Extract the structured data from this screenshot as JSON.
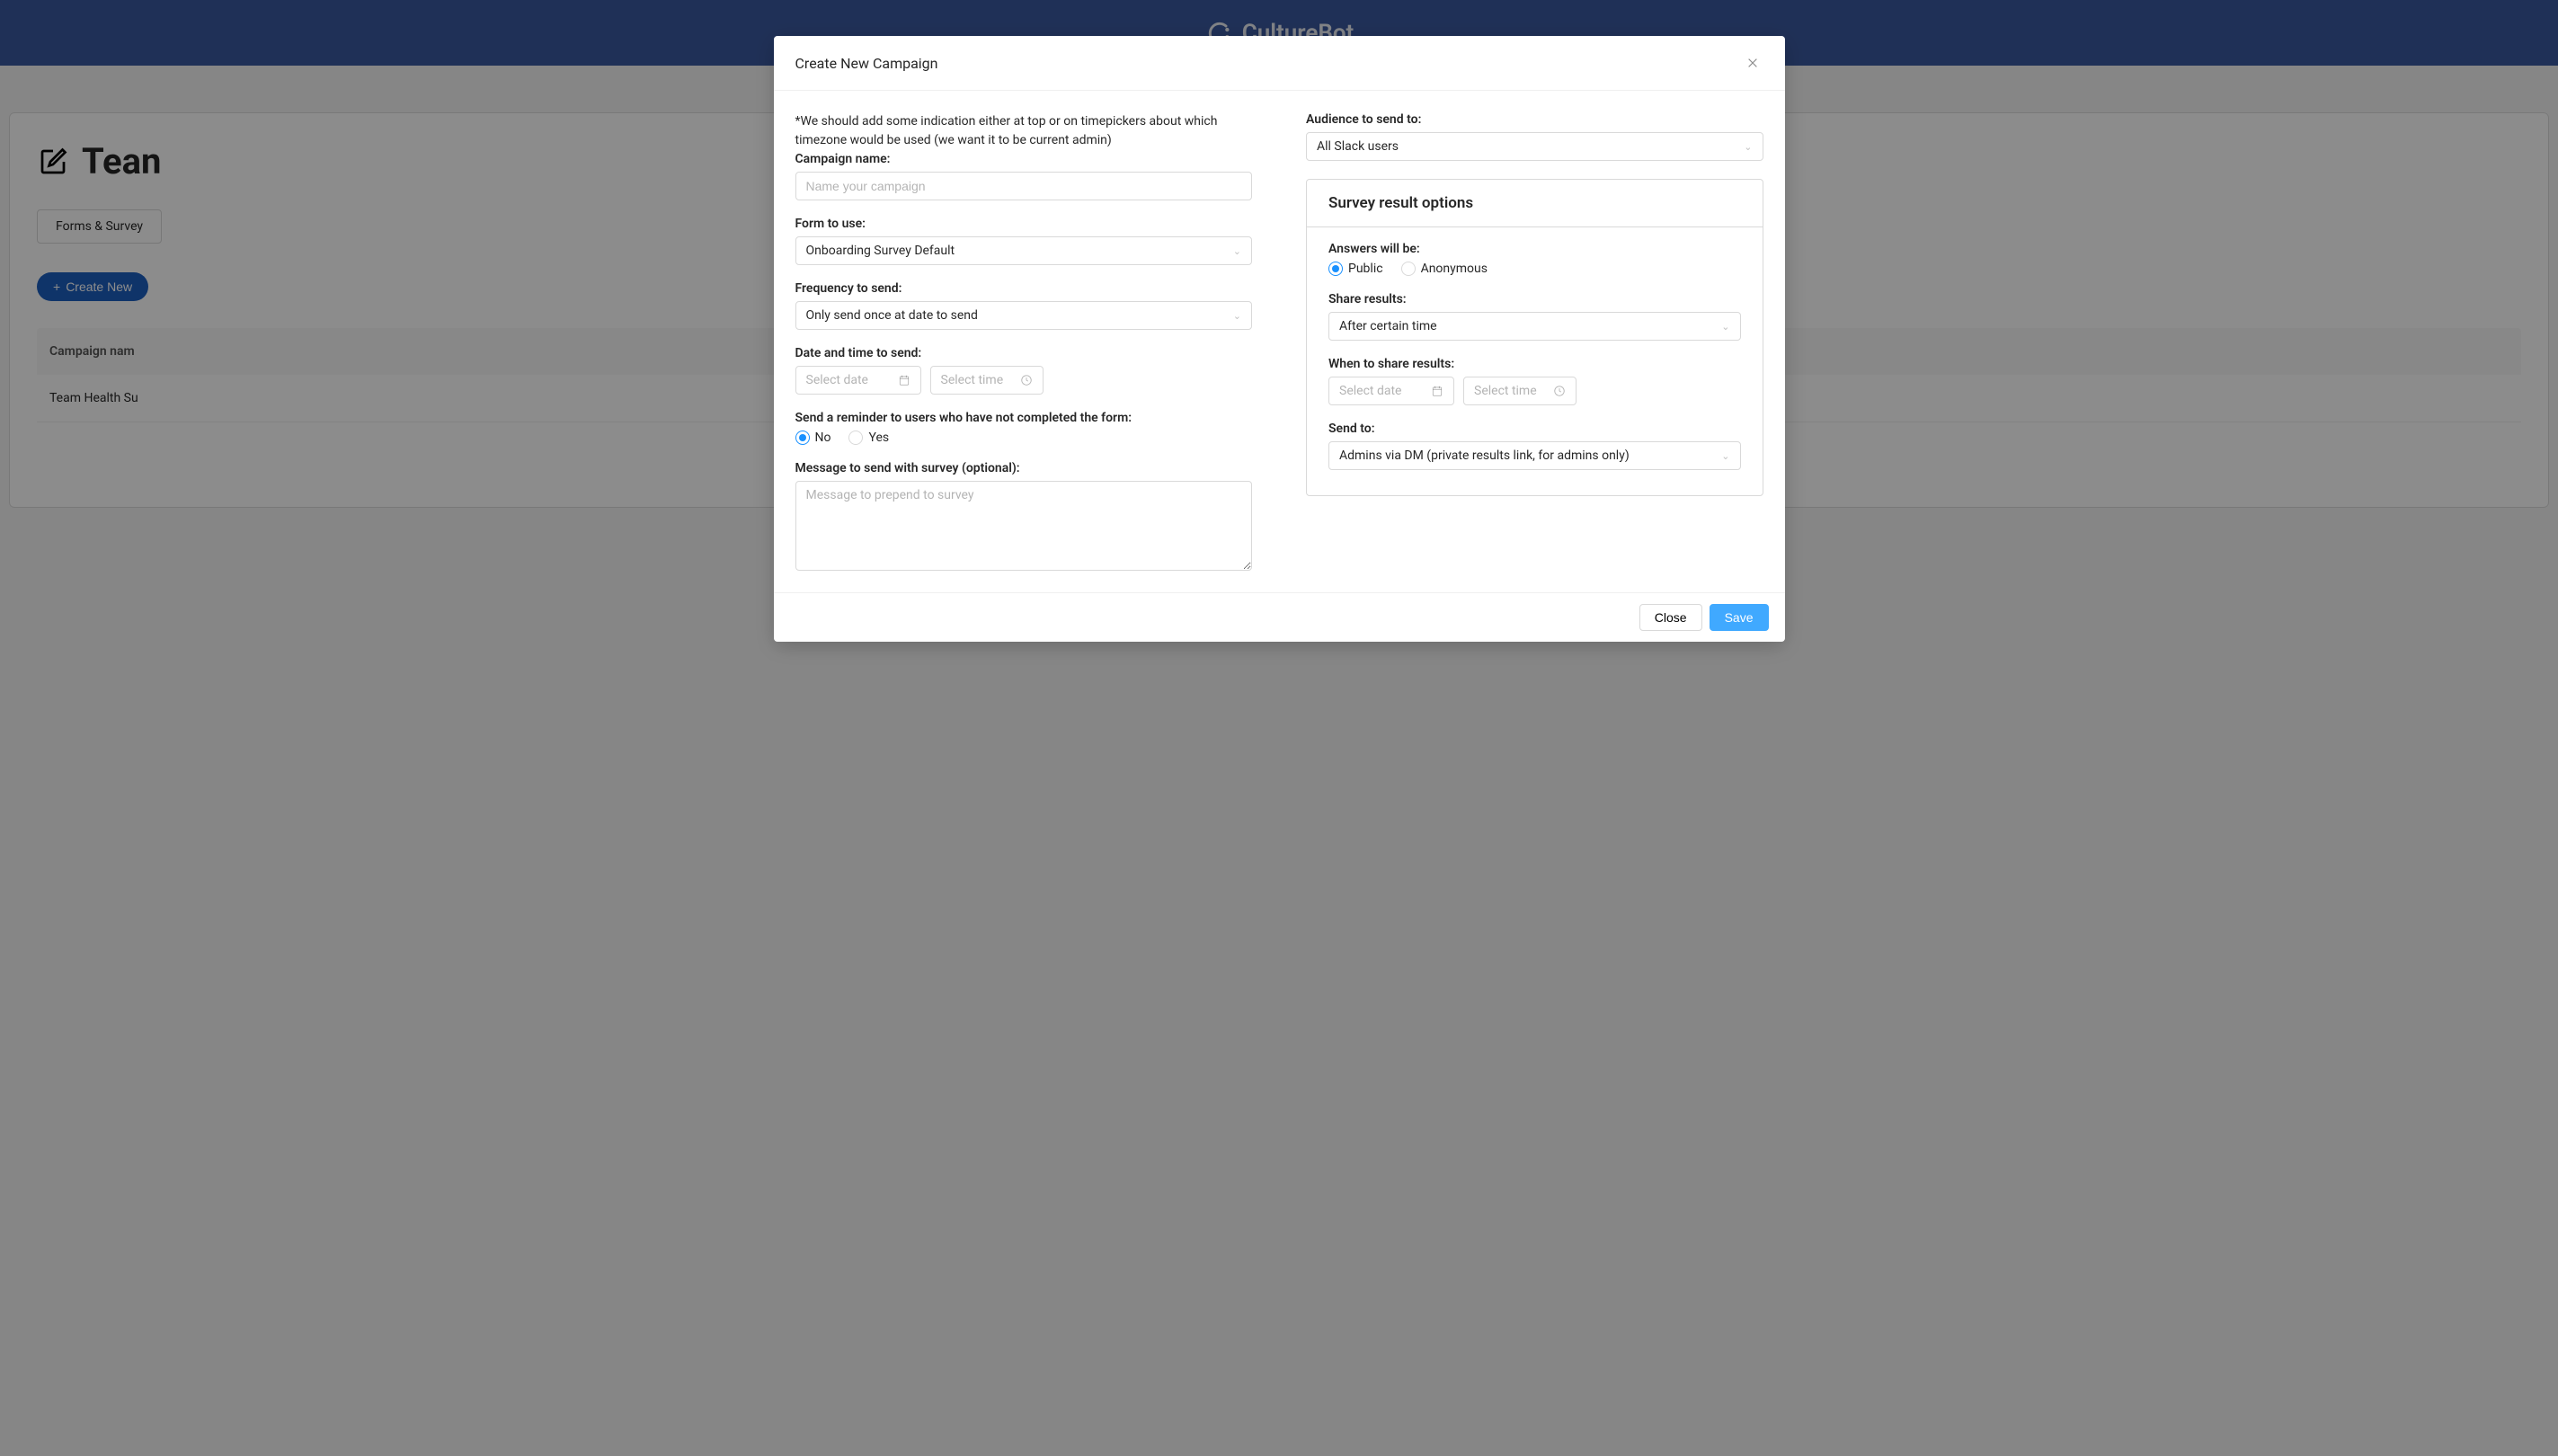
{
  "app": {
    "name": "CultureBot"
  },
  "background": {
    "page_title_prefix": "Tean",
    "tab_label": "Forms & Survey",
    "create_btn": "Create New",
    "table_header_col": "Campaign nam",
    "table_row_1": "Team Health Su"
  },
  "modal": {
    "title": "Create New Campaign",
    "note": "*We should add some indication either at top or on timepickers about which timezone would be used (we want it to be current admin)",
    "left": {
      "campaign_name_label": "Campaign name:",
      "campaign_name_placeholder": "Name your campaign",
      "form_label": "Form to use:",
      "form_value": "Onboarding Survey Default",
      "frequency_label": "Frequency to send:",
      "frequency_value": "Only send once at date to send",
      "datetime_label": "Date and time to send:",
      "date_placeholder": "Select date",
      "time_placeholder": "Select time",
      "reminder_label": "Send a reminder to users who have not completed the form:",
      "reminder_no": "No",
      "reminder_yes": "Yes",
      "message_label": "Message to send with survey (optional):",
      "message_placeholder": "Message to prepend to survey"
    },
    "right": {
      "audience_label": "Audience to send to:",
      "audience_value": "All Slack users",
      "panel_title": "Survey result options",
      "answers_label": "Answers will be:",
      "answers_public": "Public",
      "answers_anon": "Anonymous",
      "share_label": "Share results:",
      "share_value": "After certain time",
      "when_share_label": "When to share results:",
      "share_date_placeholder": "Select date",
      "share_time_placeholder": "Select time",
      "sendto_label": "Send to:",
      "sendto_value": "Admins via DM (private results link, for admins only)"
    },
    "footer": {
      "close": "Close",
      "save": "Save"
    }
  }
}
